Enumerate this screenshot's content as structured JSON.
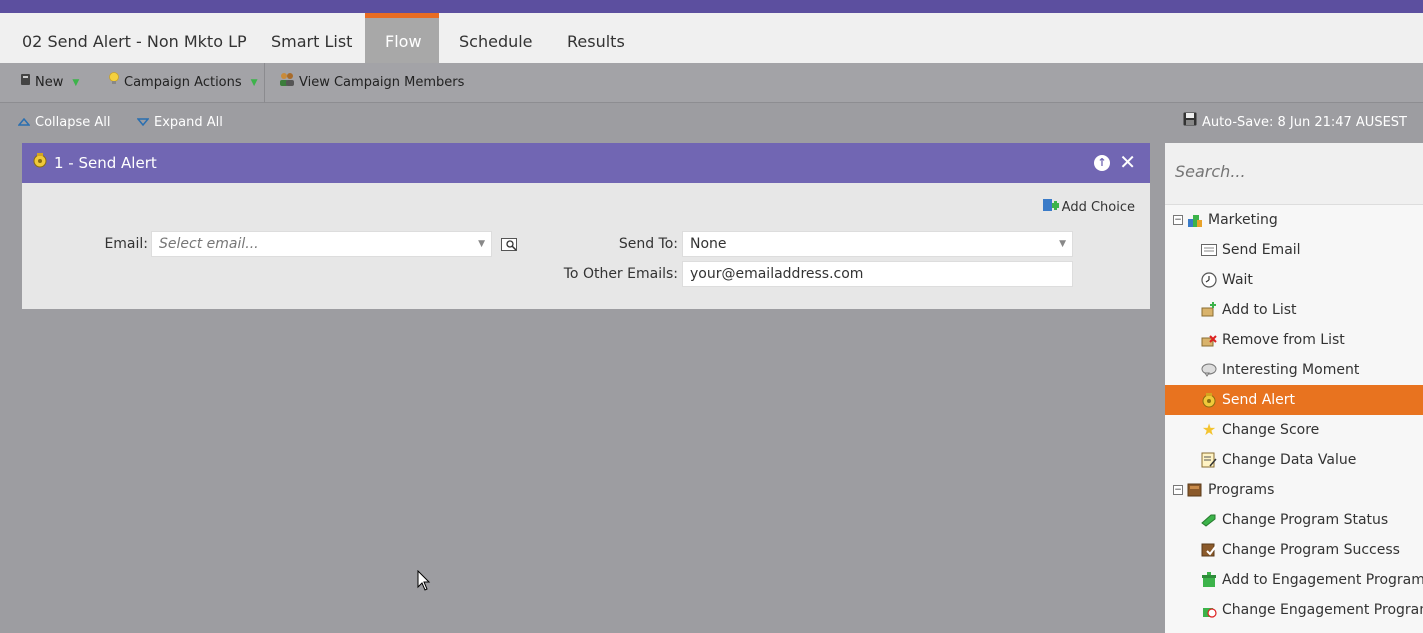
{
  "tabs": [
    {
      "label": "02 Send Alert - Non Mkto LP",
      "active": false
    },
    {
      "label": "Smart List",
      "active": false
    },
    {
      "label": "Flow",
      "active": true
    },
    {
      "label": "Schedule",
      "active": false
    },
    {
      "label": "Results",
      "active": false
    }
  ],
  "toolbar": {
    "new_label": "New",
    "campaign_actions_label": "Campaign Actions",
    "view_members_label": "View Campaign Members"
  },
  "subbar": {
    "collapse_label": "Collapse All",
    "expand_label": "Expand All",
    "autosave": "Auto-Save: 8 Jun 21:47 AUSEST"
  },
  "flow_step": {
    "title": "1 - Send Alert",
    "add_choice": "Add Choice",
    "email_label": "Email:",
    "email_placeholder": "Select email...",
    "send_to_label": "Send To:",
    "send_to_value": "None",
    "other_emails_label": "To Other Emails:",
    "other_emails_value": "your@emailaddress.com"
  },
  "panel": {
    "search_placeholder": "Search...",
    "items": [
      {
        "label": "Marketing",
        "type": "group"
      },
      {
        "label": "Send Email",
        "type": "item"
      },
      {
        "label": "Wait",
        "type": "item"
      },
      {
        "label": "Add to List",
        "type": "item"
      },
      {
        "label": "Remove from List",
        "type": "item"
      },
      {
        "label": "Interesting Moment",
        "type": "item"
      },
      {
        "label": "Send Alert",
        "type": "item",
        "selected": true
      },
      {
        "label": "Change Score",
        "type": "item"
      },
      {
        "label": "Change Data Value",
        "type": "item"
      },
      {
        "label": "Programs",
        "type": "group"
      },
      {
        "label": "Change Program Status",
        "type": "item"
      },
      {
        "label": "Change Program Success",
        "type": "item"
      },
      {
        "label": "Add to Engagement Program",
        "type": "item"
      },
      {
        "label": "Change Engagement Program Cadence",
        "type": "item"
      }
    ]
  },
  "colors": {
    "brand_purple": "#5c4f9f",
    "flow_header": "#7166b3",
    "accent_orange": "#e8731f"
  }
}
